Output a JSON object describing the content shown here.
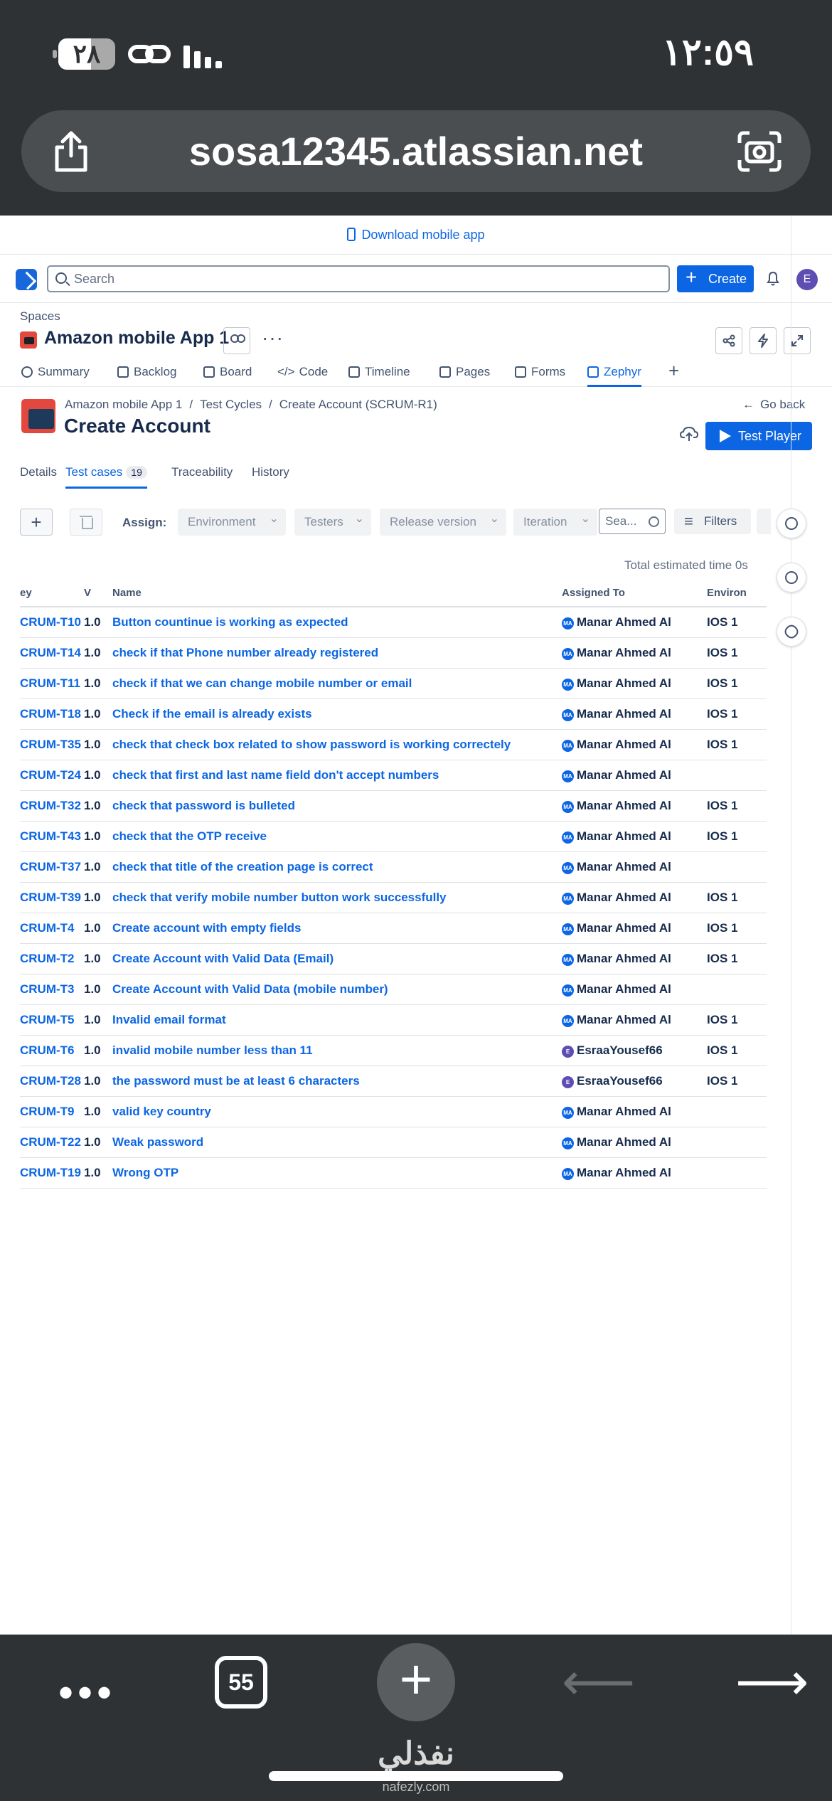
{
  "status_bar": {
    "time": "١٢:٥٩",
    "battery": "٢٨"
  },
  "browser": {
    "url": "sosa12345.atlassian.net"
  },
  "banner": {
    "download_label": "Download mobile app"
  },
  "topnav": {
    "search_placeholder": "Search",
    "create_label": "Create",
    "avatar_initial": "E"
  },
  "space": {
    "spaces_label": "Spaces",
    "project_name": "Amazon mobile App 1",
    "more": "···"
  },
  "tabs": [
    {
      "label": "Summary"
    },
    {
      "label": "Backlog"
    },
    {
      "label": "Board"
    },
    {
      "label": "Code"
    },
    {
      "label": "Timeline"
    },
    {
      "label": "Pages"
    },
    {
      "label": "Forms"
    },
    {
      "label": "Zephyr"
    }
  ],
  "breadcrumbs": [
    "Amazon mobile App 1",
    "Test Cycles",
    "Create Account (SCRUM-R1)"
  ],
  "breadcrumb_separator": "/",
  "page": {
    "title": "Create Account",
    "go_back": "Go back",
    "test_player": "Test Player"
  },
  "subtabs": {
    "details": "Details",
    "test_cases": "Test cases",
    "test_cases_count": "19",
    "traceability": "Traceability",
    "history": "History"
  },
  "toolbar": {
    "add": "+",
    "assign_label": "Assign:",
    "environment": "Environment",
    "testers": "Testers",
    "release_version": "Release version",
    "iteration": "Iteration",
    "search_placeholder": "Sea...",
    "filters": "Filters"
  },
  "total_time": "Total estimated time 0s",
  "table": {
    "headers": {
      "key": "ey",
      "version": "V",
      "name": "Name",
      "assigned": "Assigned To",
      "env": "Environ"
    },
    "rows": [
      {
        "key": "CRUM-T10",
        "v": "1.0",
        "name": "Button countinue is working as expected",
        "av": "MA",
        "assigned": "Manar Ahmed Al",
        "env": "IOS 1"
      },
      {
        "key": "CRUM-T14",
        "v": "1.0",
        "name": "check if that Phone number already registered",
        "av": "MA",
        "assigned": "Manar Ahmed Al",
        "env": "IOS 1"
      },
      {
        "key": "CRUM-T11",
        "v": "1.0",
        "name": "check if that we can change mobile number or email",
        "av": "MA",
        "assigned": "Manar Ahmed Al",
        "env": "IOS 1"
      },
      {
        "key": "CRUM-T18",
        "v": "1.0",
        "name": "Check if the email is already exists",
        "av": "MA",
        "assigned": "Manar Ahmed Al",
        "env": "IOS 1"
      },
      {
        "key": "CRUM-T35",
        "v": "1.0",
        "name": "check that check box related to show password is working correctely",
        "av": "MA",
        "assigned": "Manar Ahmed Al",
        "env": "IOS 1"
      },
      {
        "key": "CRUM-T24",
        "v": "1.0",
        "name": "check that first and last name field don't accept numbers",
        "av": "MA",
        "assigned": "Manar Ahmed Al",
        "env": ""
      },
      {
        "key": "CRUM-T32",
        "v": "1.0",
        "name": "check that password is bulleted",
        "av": "MA",
        "assigned": "Manar Ahmed Al",
        "env": "IOS 1"
      },
      {
        "key": "CRUM-T43",
        "v": "1.0",
        "name": "check that the OTP receive",
        "av": "MA",
        "assigned": "Manar Ahmed Al",
        "env": "IOS 1"
      },
      {
        "key": "CRUM-T37",
        "v": "1.0",
        "name": "check that title of the creation page is correct",
        "av": "MA",
        "assigned": "Manar Ahmed Al",
        "env": ""
      },
      {
        "key": "CRUM-T39",
        "v": "1.0",
        "name": "check that verify mobile number button work successfully",
        "av": "MA",
        "assigned": "Manar Ahmed Al",
        "env": "IOS 1"
      },
      {
        "key": "CRUM-T4",
        "v": "1.0",
        "name": "Create account with empty fields",
        "av": "MA",
        "assigned": "Manar Ahmed Al",
        "env": "IOS 1"
      },
      {
        "key": "CRUM-T2",
        "v": "1.0",
        "name": "Create Account with Valid Data (Email)",
        "av": "MA",
        "assigned": "Manar Ahmed Al",
        "env": "IOS 1"
      },
      {
        "key": "CRUM-T3",
        "v": "1.0",
        "name": "Create Account with Valid Data (mobile number)",
        "av": "MA",
        "assigned": "Manar Ahmed Al",
        "env": ""
      },
      {
        "key": "CRUM-T5",
        "v": "1.0",
        "name": "Invalid email format",
        "av": "MA",
        "assigned": "Manar Ahmed Al",
        "env": "IOS 1"
      },
      {
        "key": "CRUM-T6",
        "v": "1.0",
        "name": "invalid mobile number less than 11",
        "av": "E",
        "assigned": "EsraaYousef66",
        "env": "IOS 1"
      },
      {
        "key": "CRUM-T28",
        "v": "1.0",
        "name": "the password must be at least 6 characters",
        "av": "E",
        "assigned": "EsraaYousef66",
        "env": "IOS 1"
      },
      {
        "key": "CRUM-T9",
        "v": "1.0",
        "name": "valid key country",
        "av": "MA",
        "assigned": "Manar Ahmed Al",
        "env": ""
      },
      {
        "key": "CRUM-T22",
        "v": "1.0",
        "name": "Weak password",
        "av": "MA",
        "assigned": "Manar Ahmed Al",
        "env": ""
      },
      {
        "key": "CRUM-T19",
        "v": "1.0",
        "name": "Wrong OTP",
        "av": "MA",
        "assigned": "Manar Ahmed Al",
        "env": ""
      }
    ]
  },
  "bottom_bar": {
    "tab_count": "55"
  },
  "watermark": {
    "arabic": "نفذلي",
    "latin": "nafezly.com"
  }
}
